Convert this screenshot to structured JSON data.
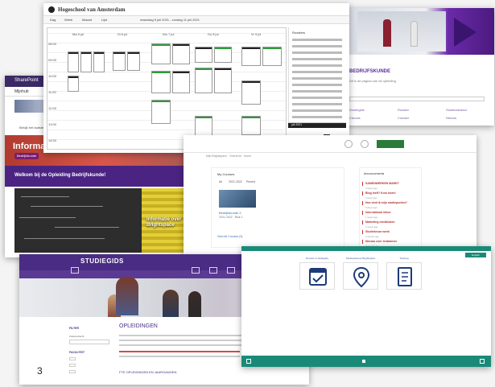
{
  "slide_number": "3",
  "purple_site": {
    "heading": "BEDRIJFSKUNDE",
    "subtext": "Dit is de pagina van de opleiding",
    "links": [
      "Studiegids",
      "Rooster",
      "Studieadviseur",
      "Canvas",
      "Contact",
      "Nieuws"
    ]
  },
  "sharepoint": {
    "app_name": "SharePoint",
    "nav_title": "Mijnhub",
    "news_text": "Bekijk het laatste nieuws",
    "hero_title": "Informatie",
    "pill_label": "Bedrijfskunde",
    "welcome": "Welkom bij de Opleiding Bedrijfskunde!",
    "tile_text": "Informatie over Brightspace"
  },
  "timetable": {
    "brand": "Hogeschool van Amsterdam",
    "toolbar": [
      "Dag",
      "Week",
      "Maand",
      "Lijst"
    ],
    "date_range": "maandag 5 juli 2021 - zondag 11 juli 2021",
    "days": [
      "Ma 5 jul",
      "Di 6 jul",
      "Wo 7 jul",
      "Do 8 jul",
      "Vr 9 jul"
    ],
    "times": [
      "08:00",
      "09:00",
      "10:00",
      "11:00",
      "12:00",
      "13:00",
      "14:00",
      "15:00",
      "16:00",
      "17:00"
    ],
    "panel_title": "Roosters",
    "cal_month": "juli 2021"
  },
  "lms": {
    "breadcrumb": "Mijn Brightspace · Overzicht · Home",
    "my_courses": "My Courses",
    "tabs": [
      "All",
      "2021-2022",
      "Pinned"
    ],
    "course_title": "Bedrijfskunde 2",
    "course_sub": "2021-2022 · Blok 1",
    "view_all": "View All Courses (3)",
    "announcements_title": "Announcements",
    "announcements": [
      {
        "title": "SAMENWERKEN MARKT",
        "meta": "2 days ago"
      },
      {
        "title": "Blog leeft? Kom lezen!",
        "meta": "3 days ago"
      },
      {
        "title": "Hoe vind ik mijn studiepunten?",
        "meta": "5 days ago"
      },
      {
        "title": "International minor",
        "meta": "1 week ago"
      },
      {
        "title": "Marketing minikluizen",
        "meta": "1 week ago"
      },
      {
        "title": "Studiekeuze week",
        "meta": "2 weeks ago"
      },
      {
        "title": "Nieuws over tentamens",
        "meta": "2 weeks ago"
      }
    ]
  },
  "studiegids": {
    "title": "STUDIEGIDS",
    "filter_label": "FILTER",
    "filter_field": "Zoekopdracht",
    "faculty_label": "FACULTEIT",
    "options_heading": "OPLEIDINGEN",
    "sub_heading": "FTE OPLEIDINGEN EN JAARGANGEN"
  },
  "teal_portal": {
    "lang_button": "English",
    "tiles": [
      {
        "label": "Rooster & studiegids",
        "icon": "calendar-check-icon"
      },
      {
        "label": "Studieadviseur Brightspace",
        "icon": "location-pin-icon"
      },
      {
        "label": "Toetsing",
        "icon": "checklist-icon"
      }
    ]
  },
  "colors": {
    "purple": "#4a2c84",
    "teal": "#1a8a78",
    "red": "#b03a2e",
    "green": "#2e9a3a"
  }
}
